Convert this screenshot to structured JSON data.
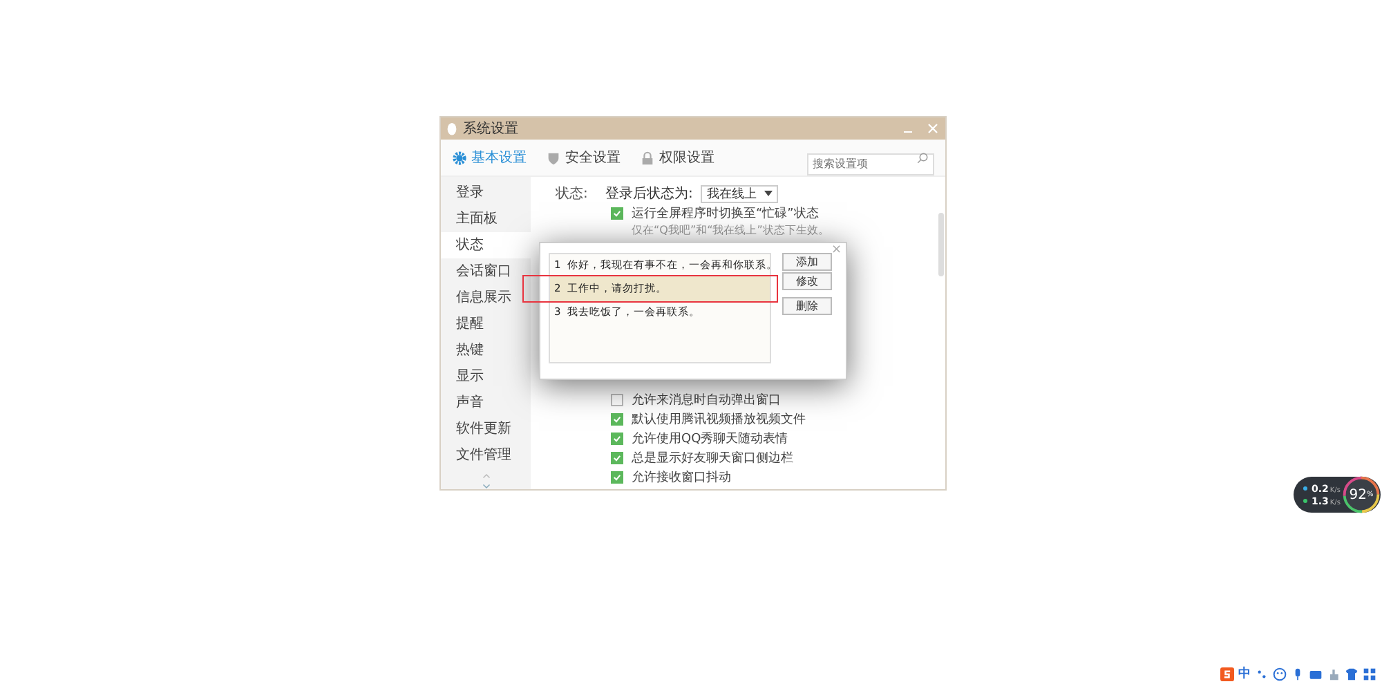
{
  "window": {
    "title": "系统设置"
  },
  "tabs": [
    {
      "label": "基本设置",
      "selected": true
    },
    {
      "label": "安全设置",
      "selected": false
    },
    {
      "label": "权限设置",
      "selected": false
    }
  ],
  "search": {
    "placeholder": "搜索设置项"
  },
  "sidebar": {
    "items": [
      {
        "label": "登录",
        "selected": false
      },
      {
        "label": "主面板",
        "selected": false
      },
      {
        "label": "状态",
        "selected": true
      },
      {
        "label": "会话窗口",
        "selected": false
      },
      {
        "label": "信息展示",
        "selected": false
      },
      {
        "label": "提醒",
        "selected": false
      },
      {
        "label": "热键",
        "selected": false
      },
      {
        "label": "显示",
        "selected": false
      },
      {
        "label": "声音",
        "selected": false
      },
      {
        "label": "软件更新",
        "selected": false
      },
      {
        "label": "文件管理",
        "selected": false
      }
    ]
  },
  "status_section": {
    "label": "状态:",
    "login_status_label": "登录后状态为:",
    "login_status_value": "我在线上",
    "busy_option": {
      "label": "运行全屏程序时切换至“忙碌”状态",
      "checked": true
    },
    "hint": "仅在“Q我吧”和“我在线上”状态下生效。"
  },
  "options": [
    {
      "label": "允许来消息时自动弹出窗口",
      "checked": false
    },
    {
      "label": "默认使用腾讯视频播放视频文件",
      "checked": true
    },
    {
      "label": "允许使用QQ秀聊天随动表情",
      "checked": true
    },
    {
      "label": "总是显示好友聊天窗口侧边栏",
      "checked": true
    },
    {
      "label": "允许接收窗口抖动",
      "checked": true
    }
  ],
  "dialog": {
    "close": "×",
    "replies": [
      {
        "index": "1",
        "text": "你好，我现在有事不在，一会再和你联系。",
        "selected": false
      },
      {
        "index": "2",
        "text": "工作中，请勿打扰。",
        "selected": true
      },
      {
        "index": "3",
        "text": "我去吃饭了，一会再联系。",
        "selected": false
      }
    ],
    "buttons": [
      "添加",
      "修改",
      "删除"
    ]
  },
  "speed_widget": {
    "upload": "0.2",
    "upload_unit": "K/s",
    "download": "1.3",
    "download_unit": "K/s",
    "percent": "92",
    "percent_unit": "%"
  },
  "ime_bar": {
    "mode": "中"
  }
}
